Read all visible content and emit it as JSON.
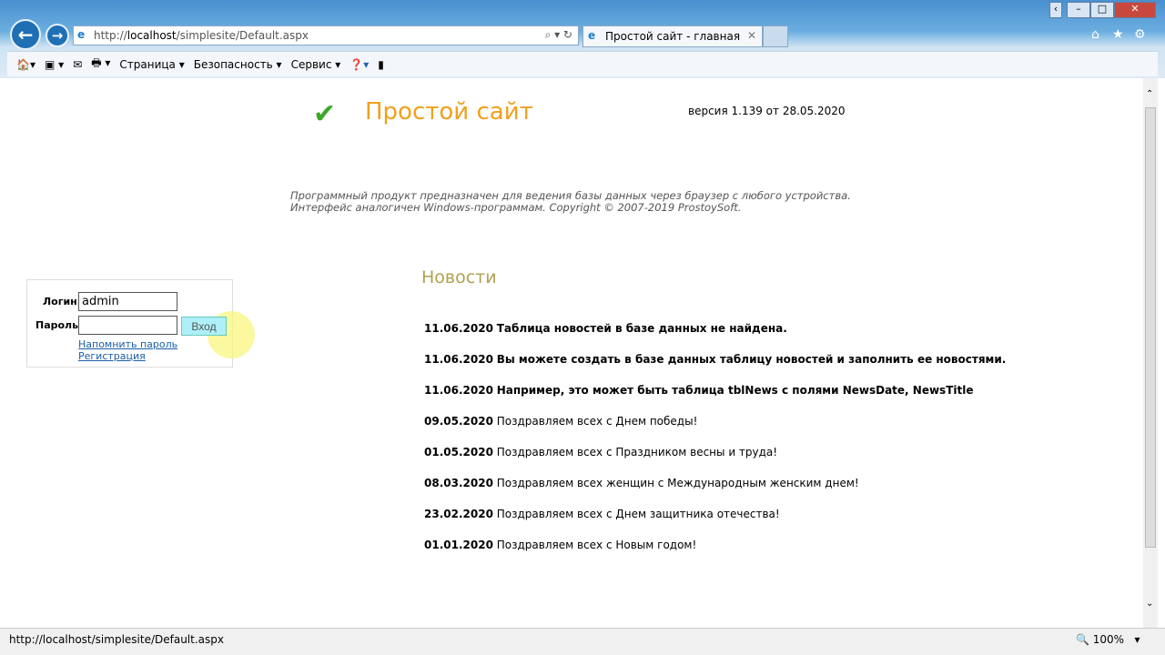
{
  "browser": {
    "url_prefix": "http://",
    "url_host": "localhost",
    "url_path": "/simplesite/Default.aspx",
    "tab_title": "Простой сайт - главная",
    "commands": {
      "page": "Страница",
      "security": "Безопасность",
      "tools": "Сервис"
    },
    "status_url": "http://localhost/simplesite/Default.aspx",
    "zoom": "100%"
  },
  "site": {
    "title": "Простой сайт",
    "version": "версия 1.139 от 28.05.2020",
    "desc1": "Программный продукт предназначен для ведения базы данных через браузер с любого устройства.",
    "desc2": "Интерфейс аналогичен Windows-программам. Copyright © 2007-2019 ProstoySoft."
  },
  "login": {
    "login_label": "Логин",
    "login_value": "admin",
    "password_label": "Пароль",
    "submit": "Вход",
    "remind": "Напомнить пароль",
    "register": "Регистрация"
  },
  "news": {
    "heading": "Новости",
    "items": [
      {
        "date": "11.06.2020",
        "text": "Таблица новостей в базе данных не найдена.",
        "bold": true
      },
      {
        "date": "11.06.2020",
        "text": "Вы можете создать в базе данных таблицу новостей и заполнить ее новостями.",
        "bold": true
      },
      {
        "date": "11.06.2020",
        "text": "Например, это может быть таблица tblNews с полями NewsDate, NewsTitle",
        "bold": true
      },
      {
        "date": "09.05.2020",
        "text": "Поздравляем всех с Днем победы!",
        "bold": false
      },
      {
        "date": "01.05.2020",
        "text": "Поздравляем всех с Праздником весны и труда!",
        "bold": false
      },
      {
        "date": "08.03.2020",
        "text": "Поздравляем всех женщин с Международным женским днем!",
        "bold": false
      },
      {
        "date": "23.02.2020",
        "text": "Поздравляем всех с Днем защитника отечества!",
        "bold": false
      },
      {
        "date": "01.01.2020",
        "text": "Поздравляем всех с Новым годом!",
        "bold": false
      }
    ]
  }
}
